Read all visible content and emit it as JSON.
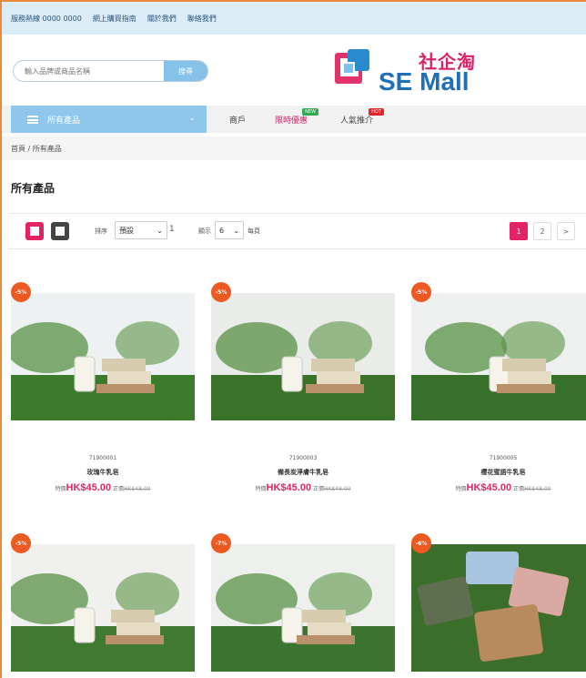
{
  "topbar": {
    "links": [
      "服務熱線 0000 0000",
      "網上購買指南",
      "關於我們",
      "聯絡我們"
    ]
  },
  "search": {
    "placeholder": "輸入品牌或商品名稱",
    "button_label": "搜尋"
  },
  "logo": {
    "cn": "社企淘",
    "en": "SE Mall"
  },
  "nav": {
    "category_label": "所有產品",
    "links": [
      {
        "label": "商戶",
        "badge": ""
      },
      {
        "label": "限時優惠",
        "badge": "NEW"
      },
      {
        "label": "人氣推介",
        "badge": "HOT"
      }
    ]
  },
  "breadcrumb": "首頁 / 所有產品",
  "page_title": "所有產品",
  "toolbar": {
    "sort_label": "排序",
    "sort_value": "預設",
    "show_label": "顯示",
    "show_value": "6",
    "per_page_suffix": "每頁",
    "page_display": "1",
    "pages": [
      "1",
      "2",
      ">"
    ]
  },
  "products": [
    {
      "discount": "-5%",
      "code": "71900001",
      "name": "玫瑰牛乳皂",
      "price_label": "特價",
      "price": "HK$45.00",
      "orig_label": "正價",
      "orig_price": "HK$48.00",
      "colors": {
        "sky": "#eef1f2",
        "grass": "#3c7a2c"
      }
    },
    {
      "discount": "-5%",
      "code": "71900003",
      "name": "備長炭淨膚牛乳皂",
      "price_label": "特價",
      "price": "HK$45.00",
      "orig_label": "正價",
      "orig_price": "HK$48.00",
      "colors": {
        "sky": "#e9ece8",
        "grass": "#3a7229"
      }
    },
    {
      "discount": "-5%",
      "code": "71900005",
      "name": "櫻花蜜語牛乳皂",
      "price_label": "特價",
      "price": "HK$45.00",
      "orig_label": "正價",
      "orig_price": "HK$48.00",
      "colors": {
        "sky": "#eef0ef",
        "grass": "#37702b"
      }
    },
    {
      "discount": "-5%",
      "code": "",
      "name": "",
      "price_label": "",
      "price": "",
      "orig_label": "",
      "orig_price": "",
      "colors": {
        "sky": "#f0f0ef",
        "grass": "#3f7a30"
      }
    },
    {
      "discount": "-7%",
      "code": "",
      "name": "",
      "price_label": "",
      "price": "",
      "orig_label": "",
      "orig_price": "",
      "colors": {
        "sky": "#eef0ee",
        "grass": "#3b7530"
      }
    },
    {
      "discount": "-6%",
      "code": "",
      "name": "",
      "price_label": "",
      "price": "",
      "orig_label": "",
      "orig_price": "",
      "colors": {
        "sky": "#4a7a34",
        "grass": "#3a6e2a"
      }
    }
  ],
  "colors": {
    "accent": "#e32366",
    "topbar": "#dcecf7",
    "category": "#8fc6ec",
    "discount": "#ec5a22"
  }
}
